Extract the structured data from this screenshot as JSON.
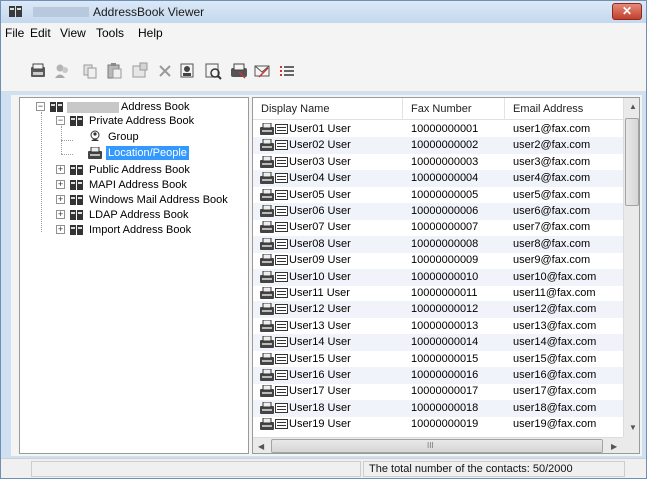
{
  "window": {
    "title": "AddressBook Viewer",
    "close_glyph": "✕"
  },
  "menu": [
    "File",
    "Edit",
    "View",
    "Tools",
    "Help"
  ],
  "toolbar": {
    "icons": [
      "new-contact-icon",
      "new-group-icon",
      "copy-icon",
      "paste-icon",
      "properties-icon",
      "delete-icon",
      "find-people-icon",
      "find-fax-icon",
      "send-fax-icon",
      "send-email-icon",
      "list-view-icon"
    ]
  },
  "tree": {
    "root": "Address Book",
    "private": "Private Address Book",
    "group": "Group",
    "location": "Location/People",
    "public": "Public Address Book",
    "mapi": "MAPI Address Book",
    "windows_mail": "Windows Mail Address Book",
    "ldap": "LDAP Address Book",
    "import": "Import Address Book",
    "expand_glyph": "+",
    "collapse_glyph": "−"
  },
  "list": {
    "columns": {
      "name": "Display Name",
      "fax": "Fax Number",
      "email": "Email Address"
    },
    "rows": [
      {
        "name": "User01 User",
        "fax": "10000000001",
        "email": "user1@fax.com"
      },
      {
        "name": "User02 User",
        "fax": "10000000002",
        "email": "user2@fax.com"
      },
      {
        "name": "User03 User",
        "fax": "10000000003",
        "email": "user3@fax.com"
      },
      {
        "name": "User04 User",
        "fax": "10000000004",
        "email": "user4@fax.com"
      },
      {
        "name": "User05 User",
        "fax": "10000000005",
        "email": "user5@fax.com"
      },
      {
        "name": "User06 User",
        "fax": "10000000006",
        "email": "user6@fax.com"
      },
      {
        "name": "User07 User",
        "fax": "10000000007",
        "email": "user7@fax.com"
      },
      {
        "name": "User08 User",
        "fax": "10000000008",
        "email": "user8@fax.com"
      },
      {
        "name": "User09 User",
        "fax": "10000000009",
        "email": "user9@fax.com"
      },
      {
        "name": "User10 User",
        "fax": "10000000010",
        "email": "user10@fax.com"
      },
      {
        "name": "User11 User",
        "fax": "10000000011",
        "email": "user11@fax.com"
      },
      {
        "name": "User12 User",
        "fax": "10000000012",
        "email": "user12@fax.com"
      },
      {
        "name": "User13 User",
        "fax": "10000000013",
        "email": "user13@fax.com"
      },
      {
        "name": "User14 User",
        "fax": "10000000014",
        "email": "user14@fax.com"
      },
      {
        "name": "User15 User",
        "fax": "10000000015",
        "email": "user15@fax.com"
      },
      {
        "name": "User16 User",
        "fax": "10000000016",
        "email": "user16@fax.com"
      },
      {
        "name": "User17 User",
        "fax": "10000000017",
        "email": "user17@fax.com"
      },
      {
        "name": "User18 User",
        "fax": "10000000018",
        "email": "user18@fax.com"
      },
      {
        "name": "User19 User",
        "fax": "10000000019",
        "email": "user19@fax.com"
      }
    ],
    "hscroll_glyph": "III",
    "arrow_up": "▲",
    "arrow_down": "▼",
    "arrow_left": "◀",
    "arrow_right": "▶"
  },
  "status": {
    "text": "The total number of the contacts: 50/2000"
  }
}
